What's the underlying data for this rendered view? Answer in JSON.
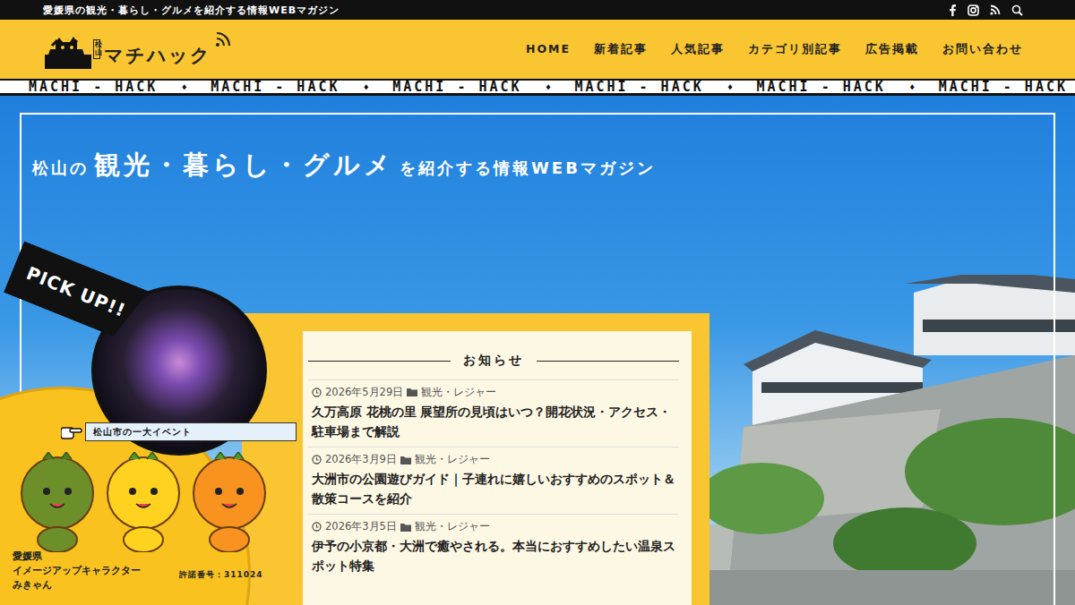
{
  "topbar": {
    "tagline": "愛媛県の観光・暮らし・グルメを紹介する情報WEBマガジン"
  },
  "logo": {
    "badge": "松山",
    "name": "マチハック"
  },
  "nav": [
    "HOME",
    "新着記事",
    "人気記事",
    "カテゴリ別記事",
    "広告掲載",
    "お問い合わせ"
  ],
  "marquee": [
    "MACHI - HACK",
    "♦",
    "MACHI - HACK",
    "♦",
    "MACHI - HACK",
    "♦",
    "MACHI - HACK",
    "♦",
    "MACHI - HACK",
    "♦",
    "MACHI - HACK"
  ],
  "hero": {
    "pre": "松山の",
    "highlight": "観光・暮らし・グルメ",
    "post": "を紹介する情報WEBマガジン"
  },
  "pickup": {
    "badge": "PICK UP!!",
    "caption": "松山市の一大イベント",
    "character_lines": [
      "愛媛県",
      "イメージアップキャラクター",
      "みきゃん"
    ],
    "permit": "許諾番号：311024"
  },
  "notices": {
    "heading": "お知らせ",
    "items": [
      {
        "date": "2026年5月29日",
        "category": "観光・レジャー",
        "title": "久万高原 花桃の里 展望所の見頃はいつ？開花状況・アクセス・駐車場まで解説"
      },
      {
        "date": "2026年3月9日",
        "category": "観光・レジャー",
        "title": "大洲市の公園遊びガイド｜子連れに嬉しいおすすめのスポット＆散策コースを紹介"
      },
      {
        "date": "2026年3月5日",
        "category": "観光・レジャー",
        "title": "伊予の小京都・大洲で癒やされる。本当におすすめしたい温泉スポット特集"
      }
    ]
  }
}
